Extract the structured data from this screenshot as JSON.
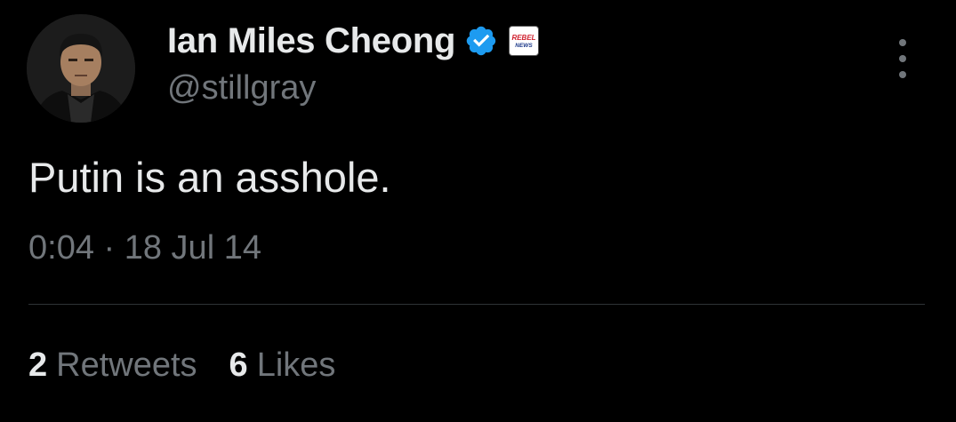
{
  "author": {
    "display_name": "Ian Miles Cheong",
    "handle": "@stillgray",
    "verified_icon": "verified-badge-icon",
    "affiliate": {
      "icon": "rebel-news-logo",
      "text_line1": "REBEL",
      "text_line2": "NEWS"
    }
  },
  "tweet": {
    "text": "Putin is an asshole.",
    "timestamp": "0:04 · 18 Jul 14"
  },
  "stats": {
    "retweets_count": "2",
    "retweets_label": "Retweets",
    "likes_count": "6",
    "likes_label": "Likes"
  },
  "colors": {
    "background": "#000000",
    "primary_text": "#e7e9ea",
    "secondary_text": "#71767b",
    "verified_blue": "#1d9bf0",
    "divider": "#2f3336",
    "rebel_red": "#d0202e"
  }
}
